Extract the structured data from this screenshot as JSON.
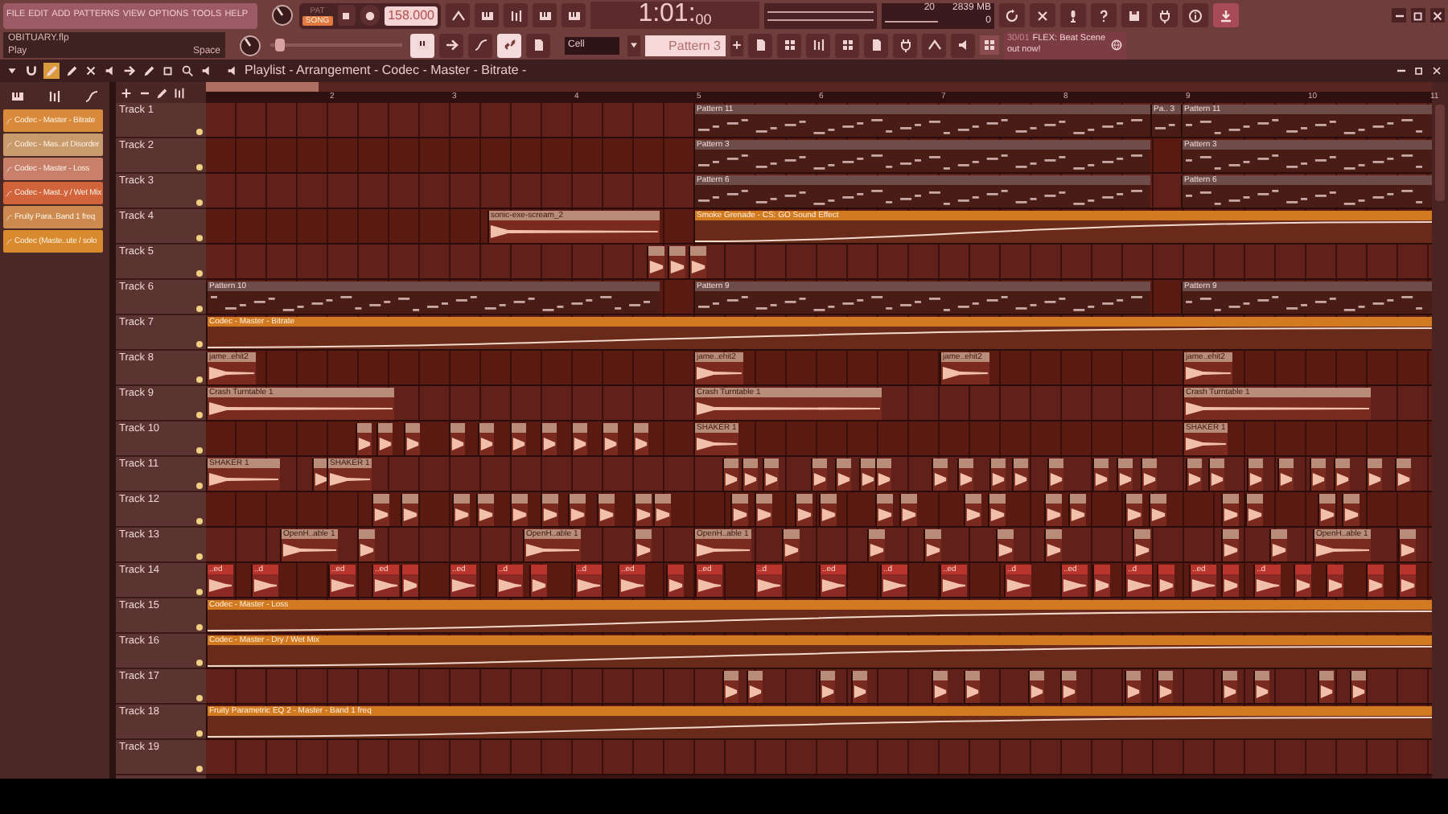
{
  "menu": [
    {
      "label": "FILE"
    },
    {
      "label": "EDIT"
    },
    {
      "label": "ADD"
    },
    {
      "label": "PATTERNS"
    },
    {
      "label": "VIEW"
    },
    {
      "label": "OPTIONS"
    },
    {
      "label": "TOOLS"
    },
    {
      "label": "HELP"
    }
  ],
  "hint_panel": {
    "title": "OBITUARY.flp",
    "action": "Play",
    "shortcut": "Space"
  },
  "transport": {
    "modes": [
      {
        "label": "PAT",
        "selected": false
      },
      {
        "label": "SONG",
        "selected": true
      }
    ],
    "tempo": "158.000",
    "time": "1:01:",
    "time_ticks": "00",
    "pitch": {
      "level": 0.04
    }
  },
  "monitor": {
    "cpu": "20",
    "memory": "2839 MB",
    "polyphony": "0"
  },
  "toolbar_toggles": [
    {
      "on": true
    },
    {
      "on": false
    },
    {
      "on": false
    },
    {
      "on": true
    },
    {
      "on": false
    }
  ],
  "snap": {
    "value": "Cell"
  },
  "pattern_selector": {
    "value": "Pattern 3"
  },
  "news": {
    "date": "30/01",
    "title": "FLEX: Beat Scene",
    "subtitle": "out now!"
  },
  "playlist": {
    "title": "Playlist - Arrangement - Codec - Master - Bitrate -",
    "clip_sources": [
      {
        "label": "Codec - Master - Bitrate",
        "color": "#d98a3a"
      },
      {
        "label": "Codec - Mas..et Disorder",
        "color": "#c99a6c"
      },
      {
        "label": "Codec - Master - Loss",
        "color": "#c8806a"
      },
      {
        "label": "Codec - Mast..y / Wet Mix",
        "color": "#d2643c"
      },
      {
        "label": "Fruity Para..Band 1 freq",
        "color": "#cc8a4e"
      },
      {
        "label": "Codec (Maste..ute / solo",
        "color": "#d88a2c"
      }
    ],
    "ruler": [
      "2",
      "3",
      "4",
      "5",
      "6",
      "7",
      "8",
      "9",
      "10",
      "11"
    ],
    "tracks": [
      {
        "name": "Track 1",
        "muted": false,
        "clips": [
          {
            "kind": "pattern",
            "label": "Pattern 11"
          },
          {
            "kind": "pattern",
            "label": "Pa.. 3"
          },
          {
            "kind": "pattern",
            "label": "Pattern 11"
          }
        ]
      },
      {
        "name": "Track 2",
        "muted": false,
        "clips": [
          {
            "kind": "pattern",
            "label": "Pattern 3"
          },
          {
            "kind": "pattern",
            "label": "Pattern 3"
          }
        ]
      },
      {
        "name": "Track 3",
        "muted": false,
        "clips": [
          {
            "kind": "pattern",
            "label": "Pattern 6"
          },
          {
            "kind": "pattern",
            "label": "Pattern 6"
          }
        ]
      },
      {
        "name": "Track 4",
        "muted": false,
        "clips": [
          {
            "kind": "audio",
            "label": "sonic-exe-scream_2"
          },
          {
            "kind": "automation",
            "label": "Smoke Grenade - CS:  GO Sound Effect"
          }
        ]
      },
      {
        "name": "Track 5",
        "muted": false
      },
      {
        "name": "Track 6",
        "muted": false,
        "clips": [
          {
            "kind": "pattern",
            "label": "Pattern 10"
          },
          {
            "kind": "pattern",
            "label": "Pattern 9"
          },
          {
            "kind": "pattern",
            "label": "Pattern 9"
          }
        ]
      },
      {
        "name": "Track 7",
        "muted": false,
        "clips": [
          {
            "kind": "automation",
            "label": "Codec - Master - Bitrate"
          }
        ]
      },
      {
        "name": "Track 8",
        "muted": false,
        "clips": [
          {
            "kind": "audio",
            "label": "jame..ehit2"
          },
          {
            "kind": "audio",
            "label": "jame..ehit2"
          },
          {
            "kind": "audio",
            "label": "jame..ehit2"
          },
          {
            "kind": "audio",
            "label": "jame..ehit2"
          }
        ]
      },
      {
        "name": "Track 9",
        "muted": false,
        "clips": [
          {
            "kind": "audio",
            "label": "Crash Turntable 1"
          },
          {
            "kind": "audio",
            "label": "Crash Turntable 1"
          },
          {
            "kind": "audio",
            "label": "Crash Turntable 1"
          }
        ]
      },
      {
        "name": "Track 10",
        "muted": false,
        "clips": [
          {
            "kind": "audio",
            "label": "SHAKER 1"
          },
          {
            "kind": "audio",
            "label": "SHAKER 1"
          }
        ]
      },
      {
        "name": "Track 11",
        "muted": false,
        "clips": [
          {
            "kind": "audio",
            "label": "SHAKER 1"
          },
          {
            "kind": "audio",
            "label": "SHAKER 1"
          }
        ]
      },
      {
        "name": "Track 12",
        "muted": false
      },
      {
        "name": "Track 13",
        "muted": false,
        "clips": [
          {
            "kind": "audio",
            "label": "OpenH..able 1"
          },
          {
            "kind": "audio",
            "label": "OpenH..able 1"
          },
          {
            "kind": "audio",
            "label": "OpenH..able 1"
          },
          {
            "kind": "audio",
            "label": "OpenH..able 1"
          }
        ]
      },
      {
        "name": "Track 14",
        "muted": false,
        "clips": [
          {
            "kind": "hit",
            "label": "..ed"
          },
          {
            "kind": "hit",
            "label": "..d"
          },
          {
            "kind": "hit",
            "label": "..ed"
          },
          {
            "kind": "hit",
            "label": "..ed"
          },
          {
            "kind": "hit",
            "label": "..ed"
          },
          {
            "kind": "hit",
            "label": "..d"
          },
          {
            "kind": "hit",
            "label": "..d"
          },
          {
            "kind": "hit",
            "label": "..ed"
          },
          {
            "kind": "hit",
            "label": "..ed"
          },
          {
            "kind": "hit",
            "label": "..d"
          },
          {
            "kind": "hit",
            "label": "..ed"
          },
          {
            "kind": "hit",
            "label": "..d"
          },
          {
            "kind": "hit",
            "label": "..ed"
          },
          {
            "kind": "hit",
            "label": "..d"
          },
          {
            "kind": "hit",
            "label": "..ed"
          },
          {
            "kind": "hit",
            "label": "..d"
          },
          {
            "kind": "hit",
            "label": "..ed"
          },
          {
            "kind": "hit",
            "label": "..d"
          }
        ]
      },
      {
        "name": "Track 15",
        "muted": false,
        "clips": [
          {
            "kind": "automation",
            "label": "Codec - Master - Loss"
          }
        ]
      },
      {
        "name": "Track 16",
        "muted": false,
        "clips": [
          {
            "kind": "automation",
            "label": "Codec - Master - Dry / Wet Mix"
          }
        ]
      },
      {
        "name": "Track 17",
        "muted": false
      },
      {
        "name": "Track 18",
        "muted": false,
        "clips": [
          {
            "kind": "automation",
            "label": "Fruity Parametric EQ 2 - Master - Band 1 freq"
          }
        ]
      },
      {
        "name": "Track 19",
        "muted": false
      }
    ]
  }
}
